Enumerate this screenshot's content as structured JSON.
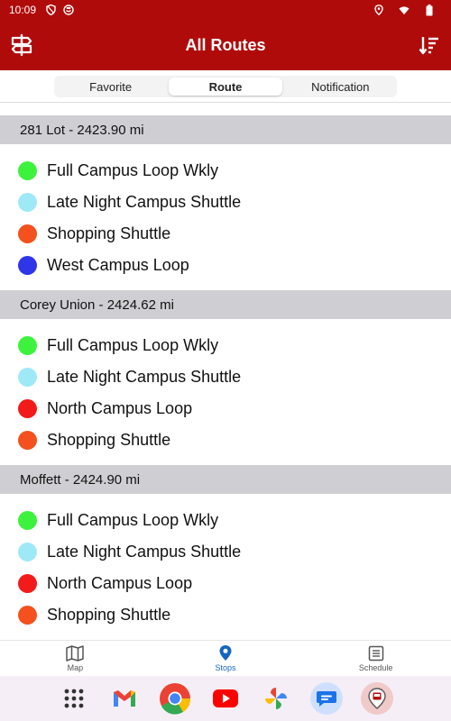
{
  "status_bar": {
    "time": "10:09"
  },
  "app_bar": {
    "title": "All Routes"
  },
  "tabs": [
    {
      "label": "Favorite",
      "active": false
    },
    {
      "label": "Route",
      "active": true
    },
    {
      "label": "Notification",
      "active": false
    }
  ],
  "stops": [
    {
      "header": "281 Lot  - 2423.90 mi",
      "routes": [
        {
          "label": "Full Campus Loop Wkly",
          "color": "#3df23d"
        },
        {
          "label": "Late Night Campus Shuttle",
          "color": "#9fe9f7"
        },
        {
          "label": "Shopping Shuttle",
          "color": "#f4511e"
        },
        {
          "label": "West Campus Loop",
          "color": "#2f35e8"
        }
      ]
    },
    {
      "header": "Corey Union - 2424.62 mi",
      "routes": [
        {
          "label": "Full Campus Loop Wkly",
          "color": "#3df23d"
        },
        {
          "label": "Late Night Campus Shuttle",
          "color": "#9fe9f7"
        },
        {
          "label": "North Campus Loop",
          "color": "#f21a1a"
        },
        {
          "label": "Shopping Shuttle",
          "color": "#f4511e"
        }
      ]
    },
    {
      "header": "Moffett - 2424.90 mi",
      "routes": [
        {
          "label": "Full Campus Loop Wkly",
          "color": "#3df23d"
        },
        {
          "label": "Late Night Campus Shuttle",
          "color": "#9fe9f7"
        },
        {
          "label": "North Campus Loop",
          "color": "#f21a1a"
        },
        {
          "label": "Shopping Shuttle",
          "color": "#f4511e"
        }
      ]
    }
  ],
  "bottom_nav": [
    {
      "label": "Map",
      "icon": "map-icon",
      "active": false
    },
    {
      "label": "Stops",
      "icon": "location-pin-icon",
      "active": true
    },
    {
      "label": "Schedule",
      "icon": "schedule-icon",
      "active": false
    }
  ],
  "dock": [
    {
      "icon": "app-drawer-icon"
    },
    {
      "icon": "gmail-icon"
    },
    {
      "icon": "chrome-icon"
    },
    {
      "icon": "youtube-icon"
    },
    {
      "icon": "photos-icon"
    },
    {
      "icon": "messages-icon"
    },
    {
      "icon": "transit-app-icon"
    }
  ],
  "colors": {
    "primary": "#b00b0b",
    "header_bg": "#cfcfd3",
    "active_nav": "#1565c0"
  }
}
